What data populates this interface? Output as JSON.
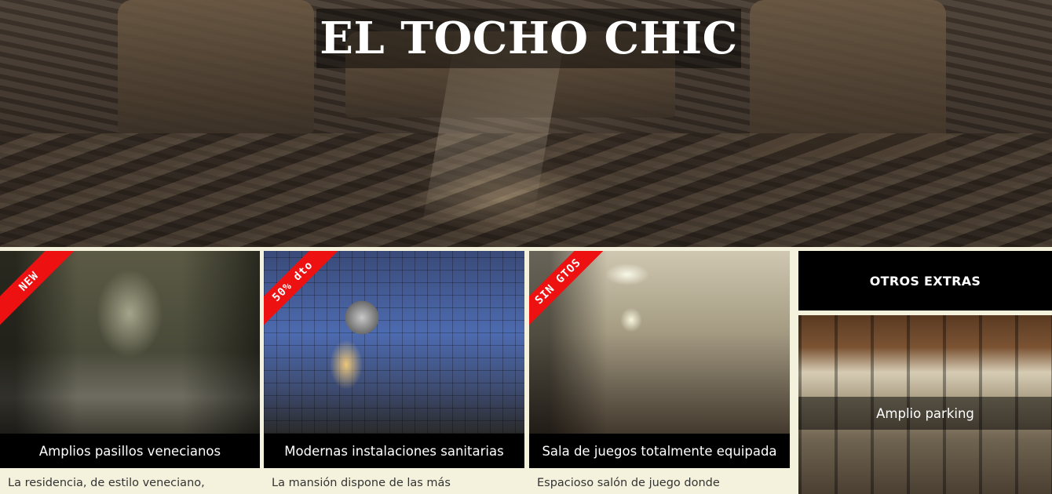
{
  "header": {
    "site_title": "EL TOCHO CHIC"
  },
  "cards": [
    {
      "badge": "NEW",
      "caption": "Amplios pasillos venecianos",
      "description": "La residencia, de estilo veneciano,"
    },
    {
      "badge": "50% dto",
      "caption": "Modernas instalaciones sanitarias",
      "description": "La mansión dispone de las más"
    },
    {
      "badge": "SIN GTOS",
      "caption": "Sala de juegos totalmente equipada",
      "description": "Espacioso salón de juego donde"
    }
  ],
  "sidebar": {
    "heading": "OTROS EXTRAS",
    "items": [
      {
        "caption": "Amplio parking"
      }
    ]
  },
  "colors": {
    "page_background": "#f4f2dc",
    "caption_bar": "#000000",
    "ribbon": "#ee1111",
    "text": "#333333"
  }
}
